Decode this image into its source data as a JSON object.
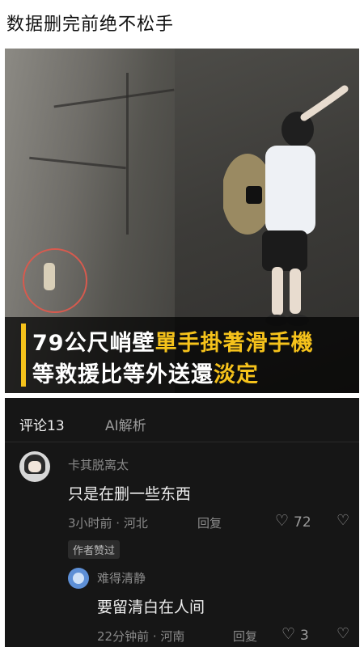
{
  "post": {
    "title": "数据删完前绝不松手"
  },
  "video": {
    "caption_line1_white": "79公尺峭壁",
    "caption_line1_yellow": "單手掛著滑手機",
    "caption_line2_white": "等救援比等外送還",
    "caption_line2_yellow": "淡定"
  },
  "comments": {
    "tab_active": "评论13",
    "tab_ai": "AI解析",
    "items": [
      {
        "user": "卡其脱离太",
        "text": "只是在删一些东西",
        "meta": "3小时前 · 河北",
        "reply_label": "回复",
        "likes": "72",
        "badge": "作者赞过"
      },
      {
        "user": "难得清静",
        "text": "要留清白在人间",
        "meta": "22分钟前 · 河南",
        "reply_label": "回复",
        "likes": "3"
      }
    ]
  },
  "icons": {
    "like": "heart-outline-icon",
    "dislike": "broken-heart-icon"
  },
  "colors": {
    "caption_accent": "#f5c21b",
    "comment_bg": "#161616",
    "circle_marker": "#d85a4e"
  }
}
